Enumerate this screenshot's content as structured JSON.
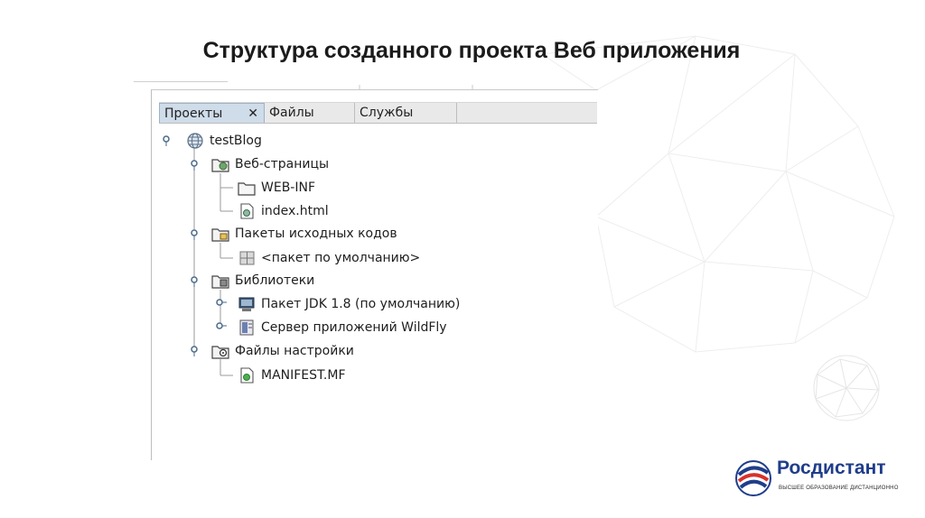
{
  "slide": {
    "title": "Структура созданного проекта Веб приложения"
  },
  "tabs": [
    {
      "label": "Проекты",
      "close": "✕",
      "active": true
    },
    {
      "label": "Файлы",
      "active": false
    },
    {
      "label": "Службы",
      "active": false
    }
  ],
  "tree": {
    "root": {
      "label": "testBlog",
      "icon": "web-project-icon"
    },
    "web_pages": {
      "label": "Веб-страницы",
      "icon": "web-folder-icon"
    },
    "web_inf": {
      "label": "WEB-INF",
      "icon": "folder-icon"
    },
    "index_html": {
      "label": "index.html",
      "icon": "html-file-icon"
    },
    "source_packages": {
      "label": "Пакеты исходных кодов",
      "icon": "package-folder-icon"
    },
    "default_package": {
      "label": "<пакет по умолчанию>",
      "icon": "package-icon"
    },
    "libraries": {
      "label": "Библиотеки",
      "icon": "library-folder-icon"
    },
    "jdk": {
      "label": "Пакет JDK 1.8 (по умолчанию)",
      "icon": "jdk-icon"
    },
    "server": {
      "label": "Сервер приложений WildFly",
      "icon": "server-icon"
    },
    "config_files": {
      "label": "Файлы настройки",
      "icon": "config-folder-icon"
    },
    "manifest": {
      "label": "MANIFEST.MF",
      "icon": "manifest-file-icon"
    }
  },
  "logo": {
    "name": "Росдистант",
    "tagline": "ВЫСШЕЕ ОБРАЗОВАНИЕ ДИСТАНЦИОННО"
  },
  "colors": {
    "title": "#1b1b1b",
    "tab_active": "#cfdce9",
    "brand_blue": "#1f3d8a",
    "brand_red": "#d6312b"
  }
}
